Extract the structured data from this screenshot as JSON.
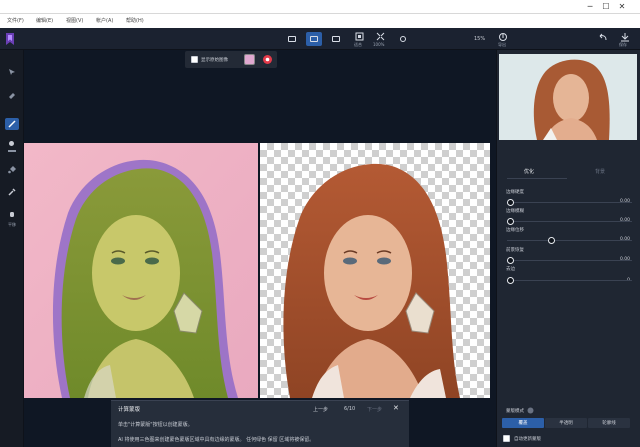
{
  "menu": [
    "文件(F)",
    "编辑(E)",
    "视图(V)",
    "帐户(A)",
    "帮助(H)"
  ],
  "window_controls": {
    "minimize": "─",
    "maximize": "☐",
    "close": "✕"
  },
  "toolbar": {
    "zoom_fit_label": "适合",
    "zoom_100_label": "100%",
    "zoom_value": "15%",
    "save_label": "导出",
    "share_label": "保存"
  },
  "subbar": {
    "show_original_label": "显示原始图像"
  },
  "left_tools": [
    "移动",
    "橡皮擦",
    "画笔",
    "填充",
    "吸管",
    "平移"
  ],
  "left_tool_hand_label": "平移",
  "right_panel": {
    "tabs": [
      "优化",
      "背景"
    ],
    "sliders": [
      {
        "label": "边缘硬度",
        "value": "0.00",
        "position": 0.0
      },
      {
        "label": "边缘模糊",
        "value": "0.00",
        "position": 0.0
      },
      {
        "label": "边缘位移",
        "value": "0.00",
        "position": 0.5
      },
      {
        "label": "前景恢复",
        "value": "0.00",
        "position": 0.0
      },
      {
        "label": "去边",
        "value": "0",
        "position": 0.0
      }
    ],
    "mask_mode_label": "蒙版模式",
    "mask_modes": [
      "覆盖",
      "半透明",
      "轮廓线"
    ],
    "auto_update_label": "自动更新蒙版"
  },
  "tip": {
    "title": "计算蒙版",
    "prev_label": "上一步",
    "page": "6/10",
    "next_label": "下一步",
    "line1": "单击\"计算蒙版\"按钮以创建蒙版。",
    "line2": "AI 将使用三色图来创建蒙色蒙版区域中具有边缘的蒙版。 任何绿色 保留 区域将被保留。"
  },
  "colors": {
    "accent": "#2c5fa8",
    "canvas_bg": "#0f1724",
    "panel_bg": "#1f2632"
  }
}
